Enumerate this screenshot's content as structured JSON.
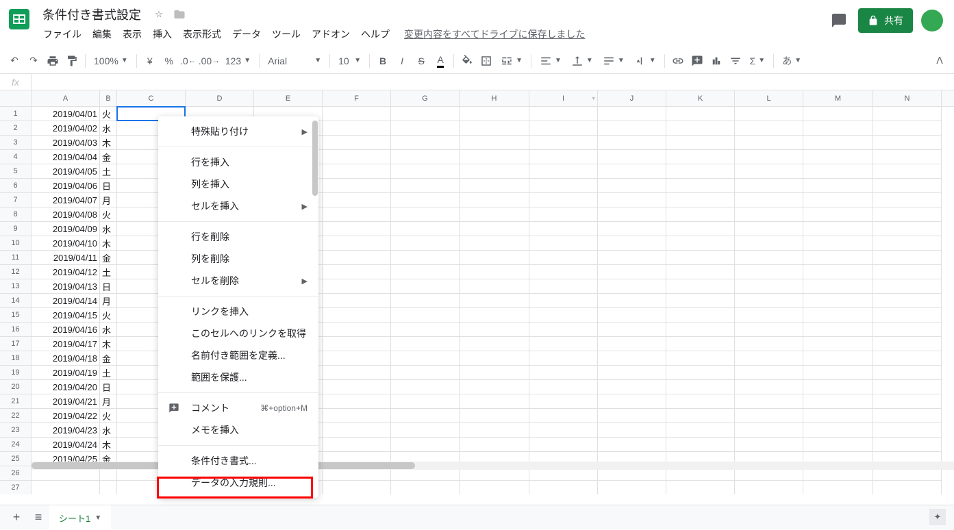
{
  "doc": {
    "title": "条件付き書式設定",
    "save_status": "変更内容をすべてドライブに保存しました"
  },
  "menubar": [
    "ファイル",
    "編集",
    "表示",
    "挿入",
    "表示形式",
    "データ",
    "ツール",
    "アドオン",
    "ヘルプ"
  ],
  "share": {
    "label": "共有"
  },
  "toolbar": {
    "zoom": "100%",
    "currency": "¥",
    "percent": "%",
    "dec_dec": ".0",
    "dec_inc": ".00",
    "more_formats": "123",
    "font": "Arial",
    "font_size": "10",
    "input_lang": "あ"
  },
  "columns": [
    "A",
    "B",
    "C",
    "D",
    "E",
    "F",
    "G",
    "H",
    "I",
    "J",
    "K",
    "L",
    "M",
    "N"
  ],
  "rows": [
    {
      "n": "1",
      "a": "2019/04/01",
      "b": "火"
    },
    {
      "n": "2",
      "a": "2019/04/02",
      "b": "水"
    },
    {
      "n": "3",
      "a": "2019/04/03",
      "b": "木"
    },
    {
      "n": "4",
      "a": "2019/04/04",
      "b": "金"
    },
    {
      "n": "5",
      "a": "2019/04/05",
      "b": "土"
    },
    {
      "n": "6",
      "a": "2019/04/06",
      "b": "日"
    },
    {
      "n": "7",
      "a": "2019/04/07",
      "b": "月"
    },
    {
      "n": "8",
      "a": "2019/04/08",
      "b": "火"
    },
    {
      "n": "9",
      "a": "2019/04/09",
      "b": "水"
    },
    {
      "n": "10",
      "a": "2019/04/10",
      "b": "木"
    },
    {
      "n": "11",
      "a": "2019/04/11",
      "b": "金"
    },
    {
      "n": "12",
      "a": "2019/04/12",
      "b": "土"
    },
    {
      "n": "13",
      "a": "2019/04/13",
      "b": "日"
    },
    {
      "n": "14",
      "a": "2019/04/14",
      "b": "月"
    },
    {
      "n": "15",
      "a": "2019/04/15",
      "b": "火"
    },
    {
      "n": "16",
      "a": "2019/04/16",
      "b": "水"
    },
    {
      "n": "17",
      "a": "2019/04/17",
      "b": "木"
    },
    {
      "n": "18",
      "a": "2019/04/18",
      "b": "金"
    },
    {
      "n": "19",
      "a": "2019/04/19",
      "b": "土"
    },
    {
      "n": "20",
      "a": "2019/04/20",
      "b": "日"
    },
    {
      "n": "21",
      "a": "2019/04/21",
      "b": "月"
    },
    {
      "n": "22",
      "a": "2019/04/22",
      "b": "火"
    },
    {
      "n": "23",
      "a": "2019/04/23",
      "b": "水"
    },
    {
      "n": "24",
      "a": "2019/04/24",
      "b": "木"
    },
    {
      "n": "25",
      "a": "2019/04/25",
      "b": "金"
    },
    {
      "n": "26",
      "a": "",
      "b": ""
    },
    {
      "n": "27",
      "a": "",
      "b": ""
    }
  ],
  "context_menu": {
    "paste_special": "特殊貼り付け",
    "insert_row": "行を挿入",
    "insert_col": "列を挿入",
    "insert_cell": "セルを挿入",
    "delete_row": "行を削除",
    "delete_col": "列を削除",
    "delete_cell": "セルを削除",
    "insert_link": "リンクを挿入",
    "get_link": "このセルへのリンクを取得",
    "define_named": "名前付き範囲を定義...",
    "protect_range": "範囲を保護...",
    "comment": "コメント",
    "comment_shortcut": "⌘+option+M",
    "insert_note": "メモを挿入",
    "conditional_formatting": "条件付き書式...",
    "data_validation": "データの入力規則..."
  },
  "sheets": {
    "tab1": "シート1"
  }
}
